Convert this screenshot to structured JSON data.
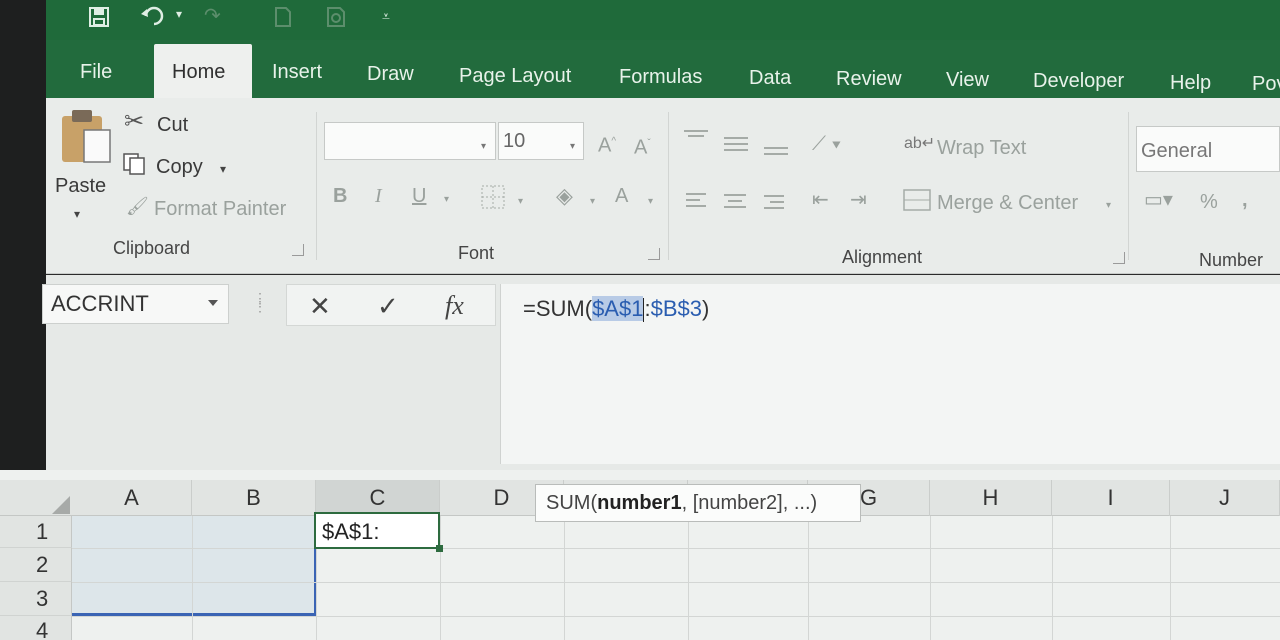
{
  "quick_access": {
    "icons": [
      "save-icon",
      "undo-icon",
      "undo-dropdown-icon",
      "redo-icon",
      "new-icon",
      "print-preview-icon",
      "customize-qat-icon"
    ]
  },
  "tabs": [
    "File",
    "Home",
    "Insert",
    "Draw",
    "Page Layout",
    "Formulas",
    "Data",
    "Review",
    "View",
    "Developer",
    "Help",
    "Pov"
  ],
  "active_tab": "Home",
  "clipboard": {
    "paste": "Paste",
    "cut": "Cut",
    "copy": "Copy",
    "format_painter": "Format Painter",
    "label": "Clipboard"
  },
  "font": {
    "font_name": "",
    "font_size": "10",
    "bold": "B",
    "italic": "I",
    "underline": "U",
    "font_color": "A",
    "label": "Font"
  },
  "alignment": {
    "wrap_text": "Wrap Text",
    "merge_center": "Merge & Center",
    "label": "Alignment"
  },
  "number": {
    "format": "General",
    "percent": "%",
    "comma": ",",
    "label": "Number"
  },
  "formula_bar": {
    "name_box": "ACCRINT",
    "cancel": "✕",
    "enter": "✓",
    "fx": "fx",
    "formula_prefix": "=SUM(",
    "ref_a": "$A$1",
    "separator": ":",
    "ref_b": "$B$3",
    "formula_suffix": ")"
  },
  "columns": [
    "A",
    "B",
    "C",
    "D",
    "E",
    "F",
    "G",
    "H",
    "I",
    "J"
  ],
  "rows": [
    "1",
    "2",
    "3",
    "4"
  ],
  "active_cell": {
    "address": "C1",
    "content": "$A$1:"
  },
  "tooltip": {
    "func": "SUM(",
    "arg1": "number1",
    "rest": ", [number2], ...)"
  },
  "colors": {
    "tab_bar": "#226b3d",
    "ribbon": "#e9ecea",
    "selection_border": "#3a64b4",
    "active_cell_border": "#2d6b3f"
  }
}
